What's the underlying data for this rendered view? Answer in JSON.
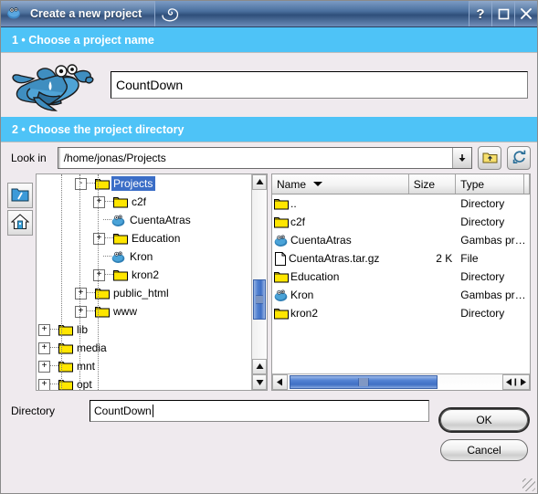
{
  "window": {
    "title": "Create a new project",
    "app_icon": "gambas-mascot-icon",
    "logo_icon": "gambas-swirl-icon",
    "buttons": [
      {
        "name": "help-button",
        "label": "?"
      },
      {
        "name": "maximize-button",
        "label": "□"
      },
      {
        "name": "close-button",
        "label": "×"
      }
    ]
  },
  "step1": {
    "header": "1 • Choose a project name",
    "mascot_icon": "gambas-shrimp-icon",
    "project_name_value": "CountDown",
    "project_name_placeholder": ""
  },
  "step2": {
    "header": "2 • Choose the project directory",
    "lookin_label": "Look in",
    "lookin_value": "/home/jonas/Projects",
    "dropdown_icon": "chevron-down-icon",
    "up_button_icon": "folder-up-icon",
    "refresh_button_icon": "refresh-icon"
  },
  "sidebar": {
    "items": [
      {
        "name": "root-folder-shortcut",
        "icon": "root-folder-icon"
      },
      {
        "name": "home-folder-shortcut",
        "icon": "home-icon"
      }
    ]
  },
  "tree": {
    "selected": "Projects",
    "nodes": [
      {
        "label": "Projects",
        "indent": 3,
        "expander": "-",
        "icon": "folder-icon",
        "selected": true
      },
      {
        "label": "c2f",
        "indent": 4,
        "expander": "+",
        "icon": "folder-icon",
        "selected": false
      },
      {
        "label": "CuentaAtras",
        "indent": 4,
        "expander": "",
        "icon": "gambas-project-icon",
        "selected": false
      },
      {
        "label": "Education",
        "indent": 4,
        "expander": "+",
        "icon": "folder-icon",
        "selected": false
      },
      {
        "label": "Kron",
        "indent": 4,
        "expander": "",
        "icon": "gambas-project-icon",
        "selected": false
      },
      {
        "label": "kron2",
        "indent": 4,
        "expander": "+",
        "icon": "folder-icon",
        "selected": false
      },
      {
        "label": "public_html",
        "indent": 3,
        "expander": "+",
        "icon": "folder-icon",
        "selected": false
      },
      {
        "label": "www",
        "indent": 3,
        "expander": "+",
        "icon": "folder-icon",
        "selected": false
      },
      {
        "label": "lib",
        "indent": 1,
        "expander": "+",
        "icon": "folder-icon",
        "selected": false
      },
      {
        "label": "media",
        "indent": 1,
        "expander": "+",
        "icon": "folder-icon",
        "selected": false
      },
      {
        "label": "mnt",
        "indent": 1,
        "expander": "+",
        "icon": "folder-icon",
        "selected": false
      },
      {
        "label": "opt",
        "indent": 1,
        "expander": "+",
        "icon": "folder-icon",
        "selected": false
      }
    ]
  },
  "filelist": {
    "columns": [
      {
        "name": "name",
        "label": "Name",
        "sorted": true
      },
      {
        "name": "size",
        "label": "Size",
        "sorted": false
      },
      {
        "name": "type",
        "label": "Type",
        "sorted": false
      },
      {
        "name": "date",
        "label": "",
        "sorted": false
      }
    ],
    "rows": [
      {
        "icon": "folder-icon",
        "name": "..",
        "size": "",
        "type": "Directory",
        "date": ""
      },
      {
        "icon": "folder-icon",
        "name": "c2f",
        "size": "",
        "type": "Directory",
        "date": ""
      },
      {
        "icon": "gambas-project-icon",
        "name": "CuentaAtras",
        "size": "",
        "type": "Gambas pr…",
        "date": ""
      },
      {
        "icon": "file-icon",
        "name": "CuentaAtras.tar.gz",
        "size": "2 K",
        "type": "File",
        "date": ""
      },
      {
        "icon": "folder-icon",
        "name": "Education",
        "size": "",
        "type": "Directory",
        "date": ""
      },
      {
        "icon": "gambas-project-icon",
        "name": "Kron",
        "size": "",
        "type": "Gambas pr…",
        "date": ""
      },
      {
        "icon": "folder-icon",
        "name": "kron2",
        "size": "",
        "type": "Directory",
        "date": ""
      }
    ]
  },
  "footer": {
    "directory_label": "Directory",
    "directory_value": "CountDown",
    "ok_label": "OK",
    "cancel_label": "Cancel"
  },
  "colors": {
    "section_header": "#4ec3f7",
    "selection": "#3b6ec7",
    "titlebar": "#35547f",
    "folder": "#ffe600",
    "window_bg": "#efeaee"
  }
}
